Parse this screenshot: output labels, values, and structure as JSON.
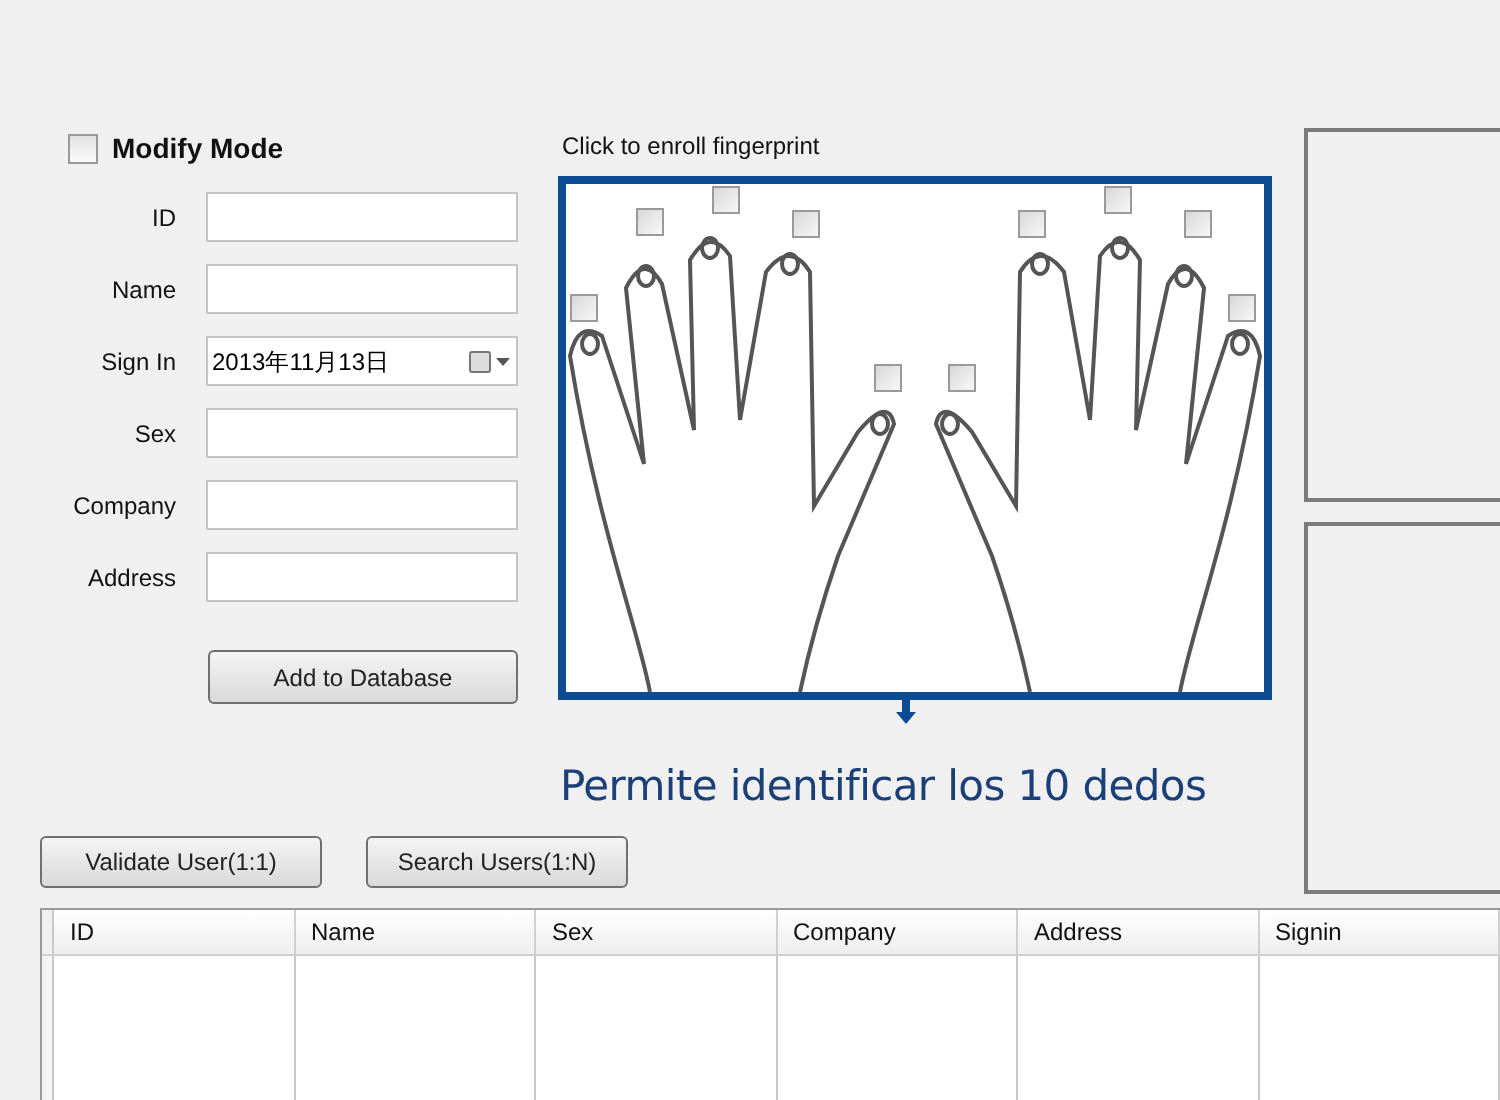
{
  "modify_mode": {
    "label": "Modify Mode",
    "checked": false
  },
  "fields": [
    {
      "label": "ID"
    },
    {
      "label": "Name"
    },
    {
      "label": "Sign In",
      "value": "2013年11月13日",
      "kind": "date"
    },
    {
      "label": "Sex"
    },
    {
      "label": "Company"
    },
    {
      "label": "Address"
    }
  ],
  "add_button": "Add to Database",
  "enroll_label": "Click to enroll fingerprint",
  "finger_checkboxes": [
    {
      "checked": false
    },
    {
      "checked": false
    },
    {
      "checked": false
    },
    {
      "checked": false
    },
    {
      "checked": false
    },
    {
      "checked": false
    },
    {
      "checked": false
    },
    {
      "checked": false
    },
    {
      "checked": false
    },
    {
      "checked": false
    }
  ],
  "caption": "Permite identificar los 10 dedos",
  "action_buttons": [
    "Validate User(1:1)",
    "Search Users(1:N)"
  ],
  "table": {
    "columns": [
      "ID",
      "Name",
      "Sex",
      "Company",
      "Address",
      "Signin"
    ]
  }
}
